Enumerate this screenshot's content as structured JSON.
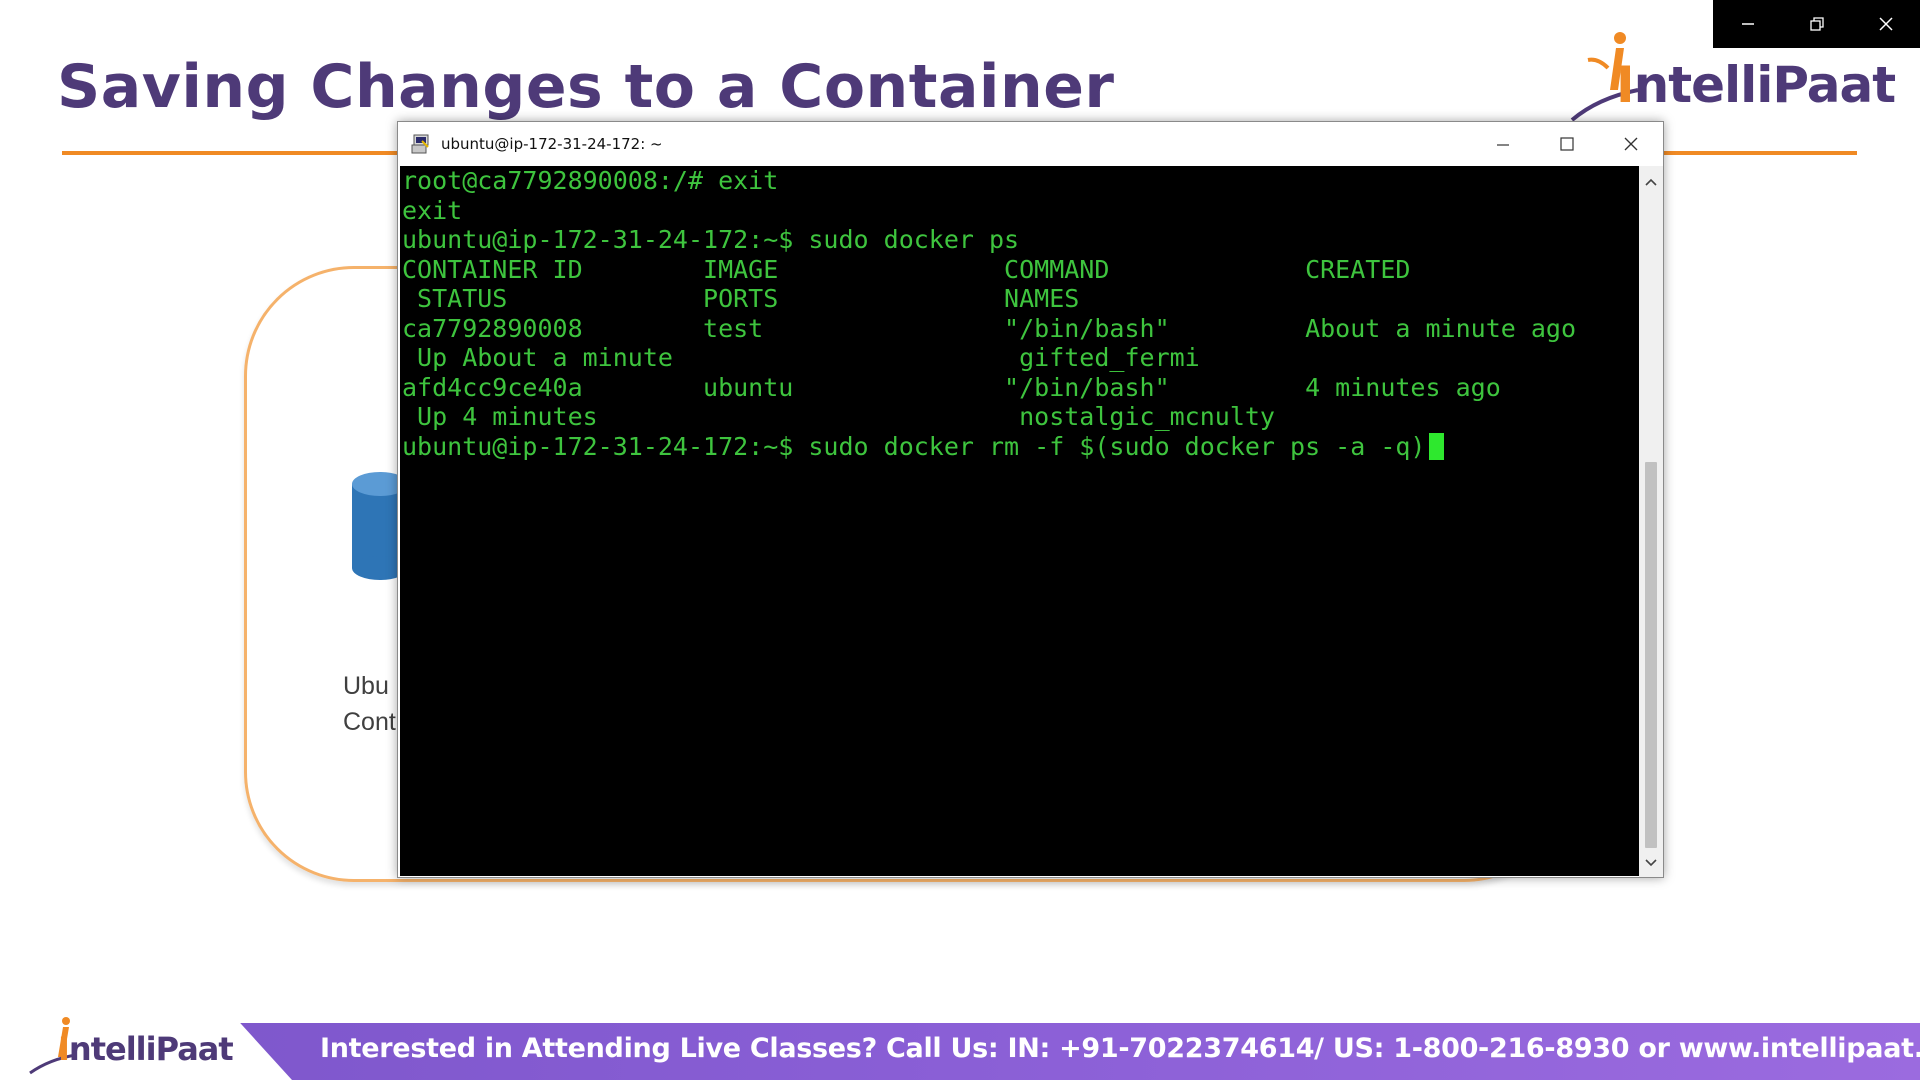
{
  "slide": {
    "title": "Saving Changes to a Container",
    "container_label_line1": "Ubu",
    "container_label_line2": "Cont"
  },
  "brand": {
    "logo_prefix": "I",
    "logo_name": "ntelliPaat",
    "accent_color": "#f08a24",
    "primary_color": "#4e3a78"
  },
  "window_controls": {
    "icons": [
      "minimize-icon",
      "restore-icon",
      "close-icon"
    ]
  },
  "terminal": {
    "title": "ubuntu@ip-172-31-24-172: ~",
    "text_color": "#3ec43e",
    "lines": [
      "root@ca7792890008:/# exit",
      "exit",
      "ubuntu@ip-172-31-24-172:~$ sudo docker ps",
      "CONTAINER ID        IMAGE               COMMAND             CREATED",
      " STATUS             PORTS               NAMES",
      "ca7792890008        test                \"/bin/bash\"         About a minute ago",
      " Up About a minute                       gifted_fermi",
      "afd4cc9ce40a        ubuntu              \"/bin/bash\"         4 minutes ago",
      " Up 4 minutes                            nostalgic_mcnulty",
      "ubuntu@ip-172-31-24-172:~$ sudo docker rm -f $(sudo docker ps -a -q)"
    ]
  },
  "banner": {
    "text": "Interested in Attending Live Classes? Call Us: IN: +91-7022374614/ US: 1-800-216-8930 or www.intellipaat.com",
    "color": "#8a5fd6"
  }
}
